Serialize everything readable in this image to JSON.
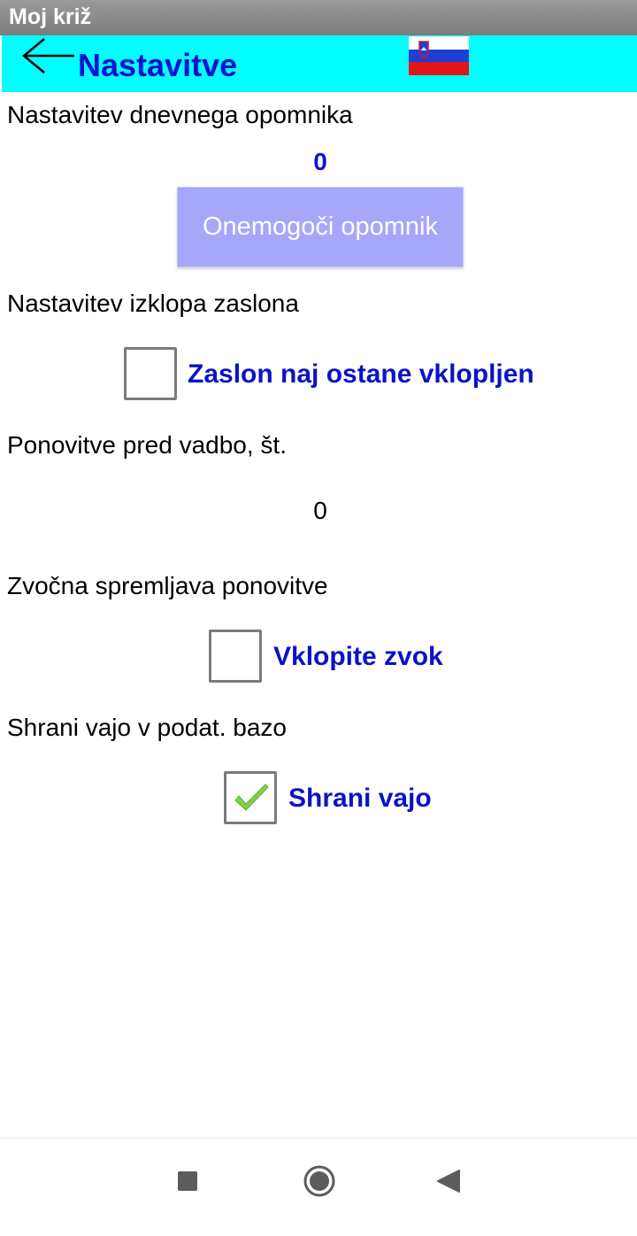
{
  "window": {
    "title": "Moj križ"
  },
  "header": {
    "title": "Nastavitve",
    "back_icon": "back-arrow-icon",
    "language_icon": "slovenian-flag-icon"
  },
  "reminder": {
    "label": "Nastavitev dnevnega opomnika",
    "value": "0",
    "disable_button_label": "Onemogoči opomnik"
  },
  "screen_timeout": {
    "label": "Nastavitev izklopa zaslona",
    "checkbox_label": "Zaslon naj ostane vklopljen",
    "checked": false
  },
  "repetitions": {
    "label": "Ponovitve pred vadbo, št.",
    "value": "0"
  },
  "sound": {
    "label": "Zvočna spremljava ponovitve",
    "checkbox_label": "Vklopite zvok",
    "checked": false
  },
  "save": {
    "label": "Shrani vajo v podat. bazo",
    "checkbox_label": "Shrani vajo",
    "checked": true
  },
  "navbar": {
    "items": [
      "recents-square-icon",
      "home-circle-icon",
      "back-triangle-icon"
    ]
  },
  "colors": {
    "header_bg": "#00ffff",
    "accent_blue": "#0b13d8",
    "button_bg": "#a6a6fa",
    "check_green": "#7fd14f"
  }
}
